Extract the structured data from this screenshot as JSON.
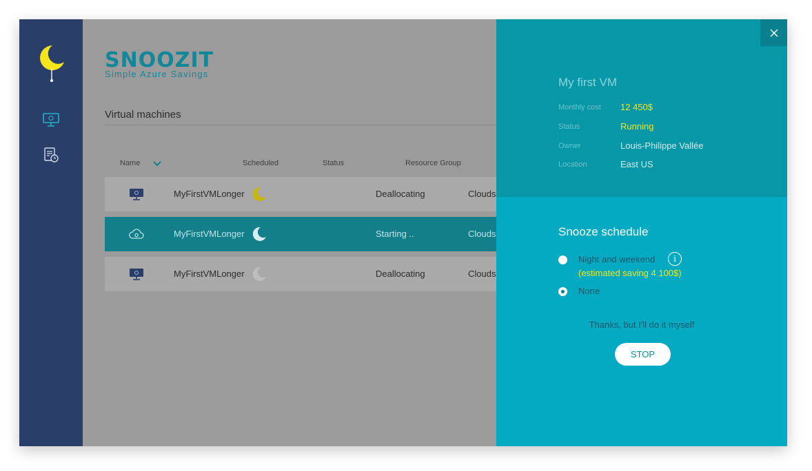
{
  "brand": {
    "name": "SNOOZIT",
    "tagline": "Simple Azure Savings"
  },
  "sidebar": {
    "items": [
      {
        "icon": "monitor-icon",
        "active": true
      },
      {
        "icon": "schedule-report-icon",
        "active": false
      }
    ]
  },
  "list": {
    "section_title": "Virtual machines",
    "columns": {
      "name": "Name",
      "scheduled": "Scheduled",
      "status": "Status",
      "resource_group": "Resource Group"
    },
    "rows": [
      {
        "name": "MyFirstVMLonger",
        "status": "Deallocating",
        "resource_group": "Clouds",
        "icon": "monitor-icon",
        "scheduled": "active"
      },
      {
        "name": "MyFirstVMLonger",
        "status": "Starting ..",
        "resource_group": "Clouds",
        "icon": "cloud-gear-icon",
        "scheduled": "on"
      },
      {
        "name": "MyFirstVMLonger",
        "status": "Deallocating",
        "resource_group": "Clouds",
        "icon": "monitor-icon",
        "scheduled": "off"
      }
    ]
  },
  "detail": {
    "title": "My first VM",
    "fields": [
      {
        "label": "Monthly cost",
        "value": "12 450$"
      },
      {
        "label": "Status",
        "value": "Running"
      },
      {
        "label": "Owner",
        "value": "Louis-Philippe Vallée"
      },
      {
        "label": "Location",
        "value": "East US"
      }
    ],
    "snooze": {
      "title": "Snooze schedule",
      "options": [
        {
          "label": "Night and weekend",
          "selected": false
        },
        {
          "label": "None",
          "selected": true
        }
      ],
      "estimated_saving": "(estimated saving 4 100$)",
      "info_glyph": "i",
      "thanks": "Thanks, but I'll do it myself",
      "stop_label": "STOP"
    }
  },
  "colors": {
    "sidebar": "#293e69",
    "main_bg": "#9b9b9b",
    "panel_top": "#0797a6",
    "panel_bottom": "#03aac2",
    "accent_yellow": "#f5e61b",
    "brand_teal": "#12879a",
    "active_row": "#127f8b"
  }
}
